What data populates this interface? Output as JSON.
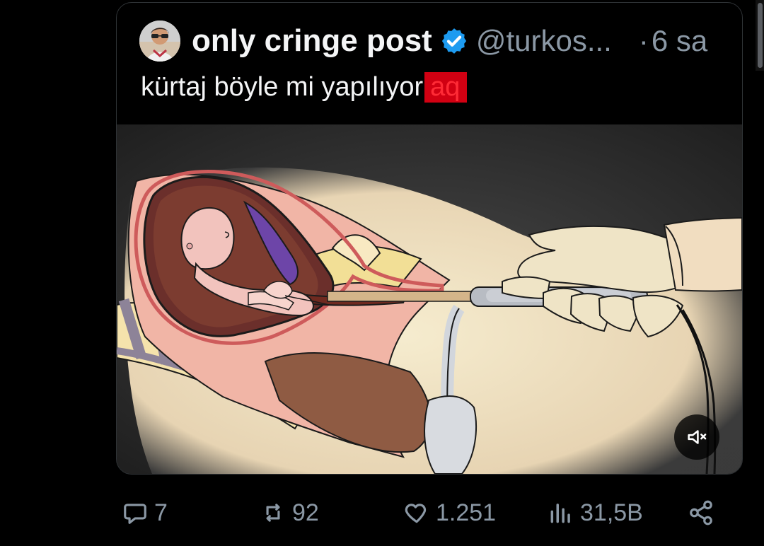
{
  "quote_tweet": {
    "display_name": "only cringe post",
    "handle": "@turkos...",
    "separator": "·",
    "time": "6 sa",
    "text_main": "kürtaj böyle mi yapılıyor",
    "text_highlight": "aq",
    "icons": {
      "avatar": "profile-avatar",
      "verified": "verified-badge-icon",
      "mute": "volume-mute-icon"
    }
  },
  "actions": {
    "replies": "7",
    "reposts": "92",
    "likes": "1.251",
    "views": "31,5B",
    "icons": [
      "reply-icon",
      "repost-icon",
      "like-icon",
      "views-icon",
      "share-icon"
    ]
  },
  "colors": {
    "background": "#000000",
    "text_primary": "#f4f5f6",
    "text_secondary": "#8b98a5",
    "verified": "#1d9bf0",
    "highlight_bg": "#d10012",
    "highlight_text": "#ff2b36"
  }
}
